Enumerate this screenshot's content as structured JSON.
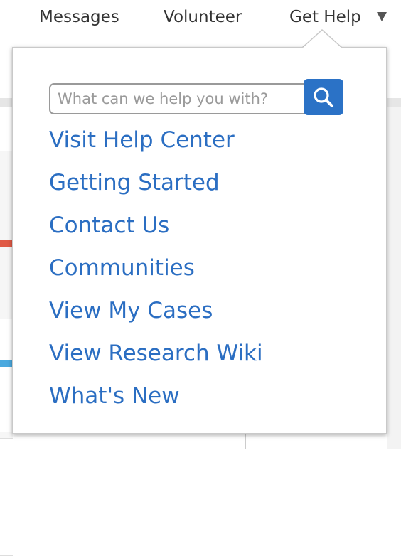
{
  "nav": {
    "items": [
      "Messages",
      "Volunteer",
      "Get Help"
    ],
    "caret_icon": "caret-down-icon"
  },
  "help_menu": {
    "search": {
      "placeholder": "What can we help you with?",
      "value": "",
      "button_icon": "search-icon"
    },
    "links": [
      "Visit Help Center",
      "Getting Started",
      "Contact Us",
      "Communities",
      "View My Cases",
      "View Research Wiki",
      "What's New"
    ]
  },
  "colors": {
    "link": "#2b6ec2",
    "search_button": "#2b72c6",
    "nav_text": "#333333"
  }
}
